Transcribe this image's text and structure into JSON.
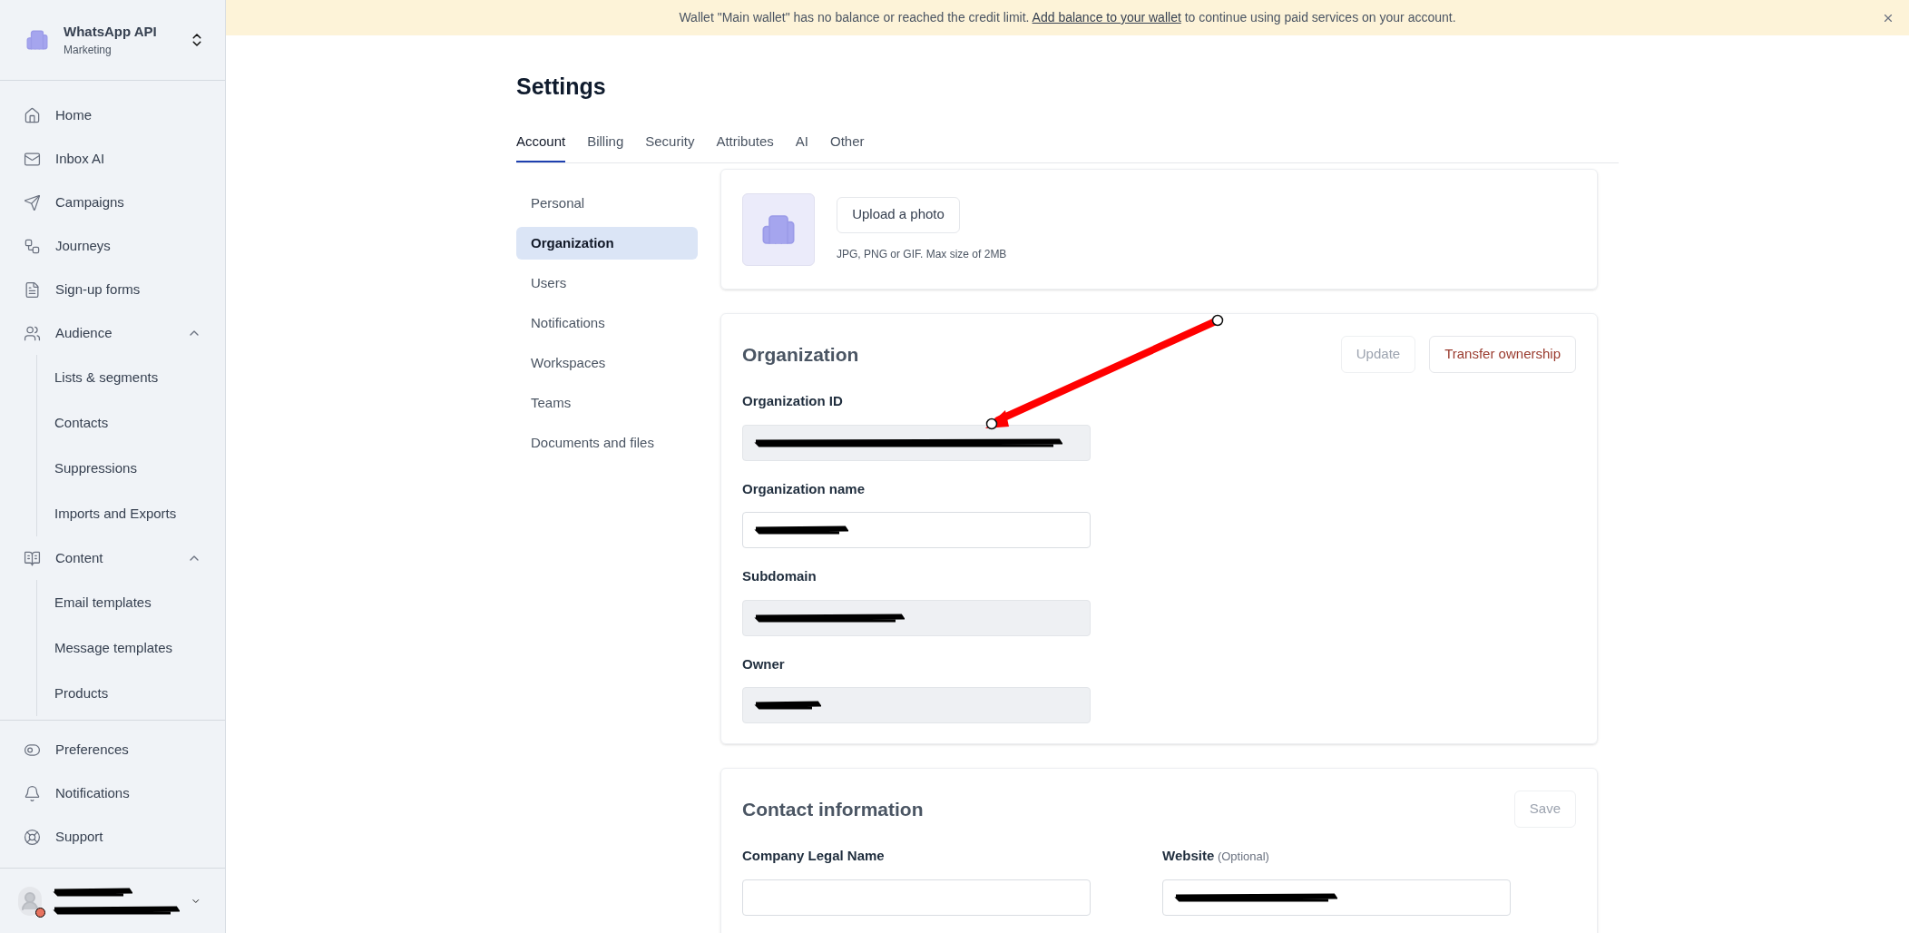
{
  "workspace": {
    "name": "WhatsApp API",
    "subtitle": "Marketing"
  },
  "sidebar": {
    "items": [
      {
        "kind": "item",
        "label": "Home"
      },
      {
        "kind": "item",
        "label": "Inbox AI"
      },
      {
        "kind": "item",
        "label": "Campaigns"
      },
      {
        "kind": "item",
        "label": "Journeys"
      },
      {
        "kind": "item",
        "label": "Sign-up forms"
      },
      {
        "kind": "group",
        "label": "Audience",
        "expanded": true,
        "children": [
          {
            "label": "Lists & segments"
          },
          {
            "label": "Contacts"
          },
          {
            "label": "Suppressions"
          },
          {
            "label": "Imports and Exports"
          }
        ]
      },
      {
        "kind": "group",
        "label": "Content",
        "expanded": true,
        "children": [
          {
            "label": "Email templates"
          },
          {
            "label": "Message templates"
          },
          {
            "label": "Products"
          }
        ]
      }
    ],
    "bottom_items": [
      {
        "label": "Preferences"
      },
      {
        "label": "Notifications"
      },
      {
        "label": "Support"
      }
    ]
  },
  "banner": {
    "before": "Wallet \"Main wallet\" has no balance or reached the credit limit.",
    "link": "Add balance to your wallet",
    "after": "to continue using paid services on your account."
  },
  "page_title": "Settings",
  "tabs": [
    {
      "label": "Account",
      "selected": true
    },
    {
      "label": "Billing",
      "selected": false
    },
    {
      "label": "Security",
      "selected": false
    },
    {
      "label": "Attributes",
      "selected": false
    },
    {
      "label": "AI",
      "selected": false
    },
    {
      "label": "Other",
      "selected": false
    }
  ],
  "subnav": [
    {
      "label": "Personal",
      "selected": false
    },
    {
      "label": "Organization",
      "selected": true
    },
    {
      "label": "Users",
      "selected": false
    },
    {
      "label": "Notifications",
      "selected": false
    },
    {
      "label": "Workspaces",
      "selected": false
    },
    {
      "label": "Teams",
      "selected": false
    },
    {
      "label": "Documents and files",
      "selected": false
    }
  ],
  "photo_card": {
    "button": "Upload a photo",
    "hint": "JPG, PNG or GIF. Max size of 2MB"
  },
  "organization": {
    "title": "Organization",
    "buttons": [
      {
        "label": "Update",
        "disabled": true
      },
      {
        "label": "Transfer ownership",
        "kind": "danger",
        "disabled": false
      }
    ],
    "fields": [
      {
        "label": "Organization ID",
        "disabled": true
      },
      {
        "label": "Organization name",
        "disabled": false
      },
      {
        "label": "Subdomain",
        "disabled": true
      },
      {
        "label": "Owner",
        "disabled": true
      }
    ]
  },
  "contact": {
    "title": "Contact information",
    "buttons": [
      {
        "label": "Save",
        "disabled": true
      }
    ],
    "fields": [
      {
        "label": "Company Legal Name",
        "disabled": false
      },
      {
        "label": "Website",
        "note": "(Optional)",
        "disabled": false
      }
    ]
  }
}
